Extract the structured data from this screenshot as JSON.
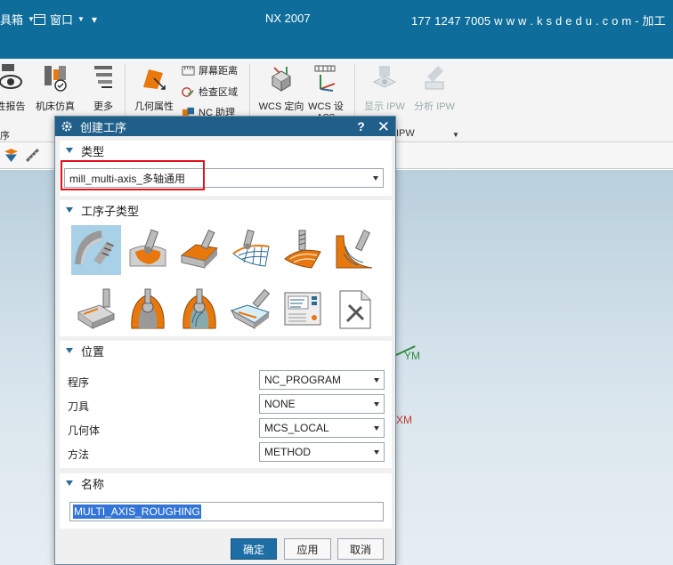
{
  "titlebar": {
    "menu_tools": "具箱",
    "menu_window": "窗口",
    "menu_extra": "▾",
    "app_title": "NX 2007",
    "contact": "177 1247 7005  w w w . k s d e d u . c o m - 加工"
  },
  "ribbon": {
    "btn_report": "性报告",
    "btn_machine_sim": "机床仿真",
    "btn_more": "更多",
    "btn_geom_props": "几何属性",
    "btn_screen_dist": "屏幕距离",
    "btn_check_region": "检查区域",
    "btn_nc_helper": "NC 助理",
    "btn_wcs_orient": "WCS 定向",
    "btn_wcs_set": "WCS 设",
    "btn_wcs_set2": "ACS",
    "btn_show_ipw": "显示 IPW",
    "btn_analyze_ipw": "分析 IPW",
    "group_left": "序",
    "group_ipw": "IPW"
  },
  "viewport": {
    "axis_y": "YM",
    "axis_x": "XM"
  },
  "dialog": {
    "title": "创建工序",
    "help": "?",
    "close": "✕",
    "type_section": "类型",
    "type_value": "mill_multi-axis_多轴通用",
    "subtype_section": "工序子类型",
    "location_section": "位置",
    "fields": [
      {
        "label": "程序",
        "value": "NC_PROGRAM"
      },
      {
        "label": "刀具",
        "value": "NONE"
      },
      {
        "label": "几何体",
        "value": "MCS_LOCAL"
      },
      {
        "label": "方法",
        "value": "METHOD"
      }
    ],
    "name_section": "名称",
    "name_value": "MULTI_AXIS_ROUGHING",
    "btn_ok": "确定",
    "btn_apply": "应用",
    "btn_cancel": "取消"
  },
  "icons": {
    "settings": "gear-icon",
    "accent": "#1f5f8a",
    "selection_highlight": "#a8d0e6",
    "tool_orange": "#e8780c"
  }
}
